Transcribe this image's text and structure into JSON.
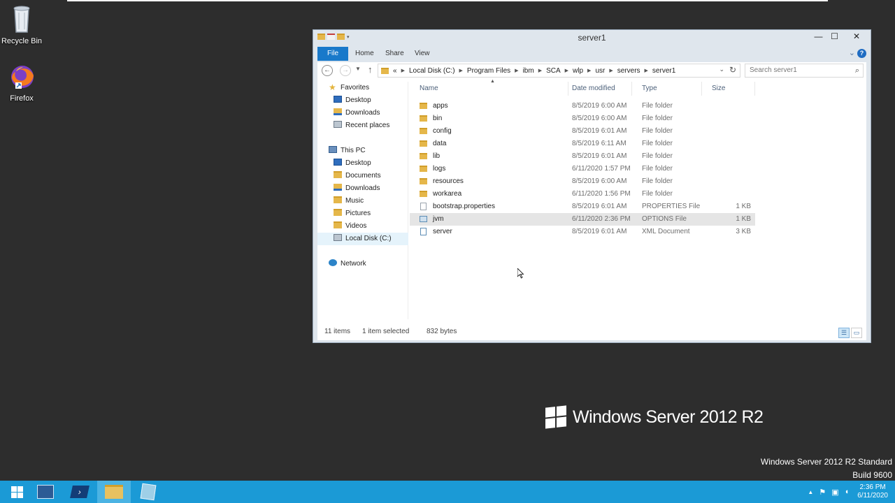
{
  "desktop": {
    "icons": [
      {
        "label": "Recycle Bin",
        "icon": "recycle-bin-icon"
      },
      {
        "label": "Firefox",
        "icon": "firefox-icon"
      }
    ],
    "brand_text": "Windows Server 2012 R2",
    "edition_line1": "Windows Server 2012 R2 Standard",
    "edition_line2": "Build 9600"
  },
  "window": {
    "title": "server1",
    "controls": {
      "minimize": "—",
      "maximize": "☐",
      "close": "✕"
    },
    "ribbon_tabs": {
      "file": "File",
      "home": "Home",
      "share": "Share",
      "view": "View"
    },
    "help": "?",
    "address": {
      "prefix": "«",
      "crumbs": [
        "Local Disk (C:)",
        "Program Files",
        "ibm",
        "SCA",
        "wlp",
        "usr",
        "servers",
        "server1"
      ]
    },
    "search_placeholder": "Search server1",
    "nav": {
      "favorites": "Favorites",
      "fav_desktop": "Desktop",
      "fav_downloads": "Downloads",
      "fav_recent": "Recent places",
      "this_pc": "This PC",
      "pc_desktop": "Desktop",
      "pc_documents": "Documents",
      "pc_downloads": "Downloads",
      "pc_music": "Music",
      "pc_pictures": "Pictures",
      "pc_videos": "Videos",
      "pc_local_disk": "Local Disk (C:)",
      "network": "Network"
    },
    "columns": {
      "name": "Name",
      "date": "Date modified",
      "type": "Type",
      "size": "Size"
    },
    "files": [
      {
        "name": "apps",
        "date": "8/5/2019 6:00 AM",
        "type": "File folder",
        "size": "",
        "kind": "folder"
      },
      {
        "name": "bin",
        "date": "8/5/2019 6:00 AM",
        "type": "File folder",
        "size": "",
        "kind": "folder"
      },
      {
        "name": "config",
        "date": "8/5/2019 6:01 AM",
        "type": "File folder",
        "size": "",
        "kind": "folder"
      },
      {
        "name": "data",
        "date": "8/5/2019 6:11 AM",
        "type": "File folder",
        "size": "",
        "kind": "folder"
      },
      {
        "name": "lib",
        "date": "8/5/2019 6:01 AM",
        "type": "File folder",
        "size": "",
        "kind": "folder"
      },
      {
        "name": "logs",
        "date": "6/11/2020 1:57 PM",
        "type": "File folder",
        "size": "",
        "kind": "folder"
      },
      {
        "name": "resources",
        "date": "8/5/2019 6:00 AM",
        "type": "File folder",
        "size": "",
        "kind": "folder"
      },
      {
        "name": "workarea",
        "date": "6/11/2020 1:56 PM",
        "type": "File folder",
        "size": "",
        "kind": "folder"
      },
      {
        "name": "bootstrap.properties",
        "date": "8/5/2019 6:01 AM",
        "type": "PROPERTIES File",
        "size": "1 KB",
        "kind": "file"
      },
      {
        "name": "jvm",
        "date": "6/11/2020 2:36 PM",
        "type": "OPTIONS File",
        "size": "1 KB",
        "kind": "options"
      },
      {
        "name": "server",
        "date": "8/5/2019 6:01 AM",
        "type": "XML Document",
        "size": "3 KB",
        "kind": "xml"
      }
    ],
    "selected_file": "jvm",
    "status": {
      "items": "11 items",
      "selection": "1 item selected",
      "bytes": "832 bytes"
    }
  },
  "taskbar": {
    "apps": [
      "start",
      "server-manager",
      "powershell",
      "file-explorer",
      "notepad"
    ],
    "tray_arrow": "▲",
    "time": "2:36 PM",
    "date": "6/11/2020"
  }
}
